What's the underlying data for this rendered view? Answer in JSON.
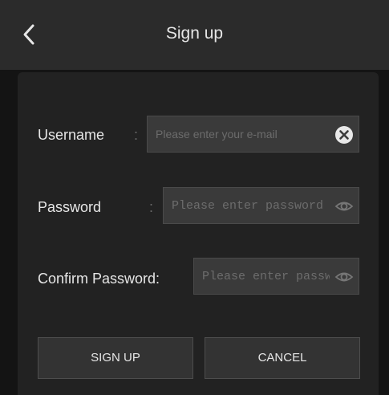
{
  "header": {
    "title": "Sign up",
    "back_icon": "chevron-left-icon"
  },
  "form": {
    "username": {
      "label": "Username",
      "colon": ":",
      "placeholder": "Please enter your e-mail",
      "value": "",
      "icon": "clear-circle-icon"
    },
    "password": {
      "label": "Password",
      "colon": ":",
      "placeholder": "Please enter password",
      "value": "",
      "icon": "eye-icon"
    },
    "confirm_password": {
      "label": "Confirm Password:",
      "placeholder": "Please enter password",
      "value": "",
      "icon": "eye-icon"
    }
  },
  "buttons": {
    "sign_up": "SIGN UP",
    "cancel": "CANCEL"
  },
  "colors": {
    "background": "#141414",
    "header": "#2b2b2b",
    "card": "#222222",
    "field": "#3a3a3a",
    "button": "#333333",
    "text": "#e6e6e6"
  }
}
